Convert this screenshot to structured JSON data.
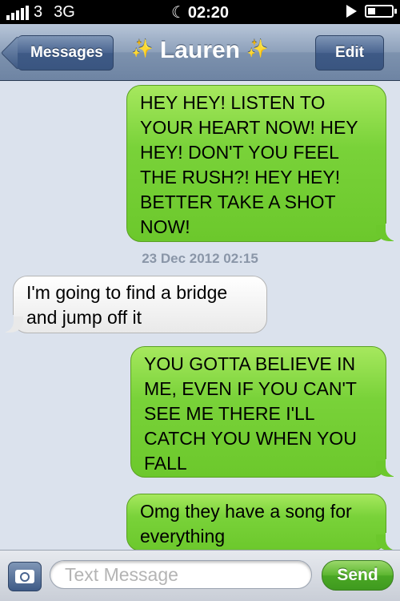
{
  "status_bar": {
    "carrier": "3",
    "network": "3G",
    "time": "02:20",
    "moon_icon": "moon-icon",
    "play_icon": "play-icon",
    "battery_icon": "battery-icon"
  },
  "nav": {
    "back_label": "Messages",
    "contact_name": "Lauren",
    "title_sparkle": "✨",
    "edit_label": "Edit"
  },
  "messages": [
    {
      "direction": "outgoing",
      "text": "HEY HEY! LISTEN TO YOUR HEART NOW! HEY HEY! DON'T YOU FEEL THE RUSH?! HEY HEY! BETTER TAKE A SHOT NOW!"
    },
    {
      "direction": "timestamp",
      "text": "23 Dec 2012 02:15"
    },
    {
      "direction": "incoming",
      "text": "I'm going to find a bridge and jump off it"
    },
    {
      "direction": "outgoing",
      "text": "YOU GOTTA BELIEVE IN ME, EVEN IF YOU CAN'T SEE ME THERE I'LL CATCH YOU WHEN YOU FALL"
    },
    {
      "direction": "outgoing",
      "text": "Omg they have a song for everything"
    }
  ],
  "compose": {
    "camera_icon": "camera-icon",
    "placeholder": "Text Message",
    "value": "",
    "send_label": "Send"
  },
  "colors": {
    "outgoing_bubble": "#79d239",
    "incoming_bubble": "#f2f2f2",
    "background": "#dbe2ed",
    "nav_accent": "#4a6591"
  }
}
